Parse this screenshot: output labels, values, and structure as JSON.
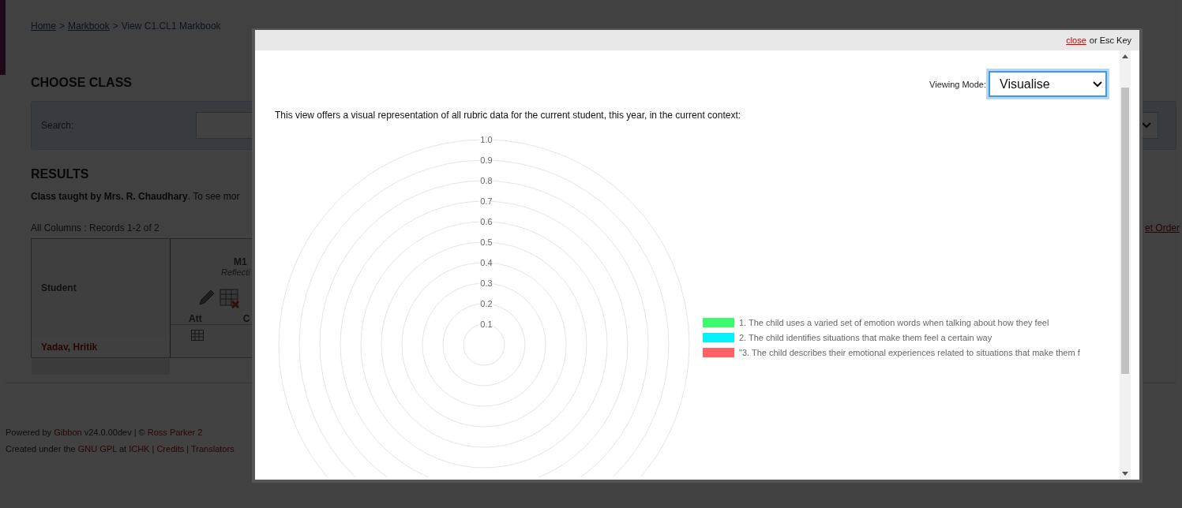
{
  "page": {
    "breadcrumb": [
      {
        "label": "Home",
        "link": true
      },
      {
        "label": "Markbook",
        "link": true
      },
      {
        "label": "View C1.CL1 Markbook",
        "link": false
      }
    ],
    "separator": ">",
    "choose_class": {
      "heading": "CHOOSE CLASS",
      "search_label": "Search:"
    },
    "results": {
      "heading": "RESULTS",
      "teacher_note": "**Class taught by Mrs. R. Chaudhary**. To see mor",
      "records": "All Columns : Records 1-2 of 2",
      "order_link": "et Order",
      "table": {
        "student_header": "Student",
        "column": {
          "title": "M1",
          "subtitle": "Reflecti",
          "sub_columns": [
            "Att",
            "C"
          ]
        },
        "rows": [
          {
            "student": "Yadav, Hritik"
          }
        ]
      }
    },
    "footer": {
      "lines": [
        [
          {
            "text": "Powered by ",
            "link": false
          },
          {
            "text": "Gibbon",
            "link": true
          },
          {
            "text": " v24.0.00dev | © ",
            "link": false
          },
          {
            "text": "Ross Parker 2",
            "link": true
          }
        ],
        [
          {
            "text": "Created under the ",
            "link": false
          },
          {
            "text": "GNU GPL",
            "link": true
          },
          {
            "text": " at ",
            "link": false
          },
          {
            "text": "ICHK",
            "link": true
          },
          {
            "text": " | ",
            "link": false
          },
          {
            "text": "Credits",
            "link": true
          },
          {
            "text": " | ",
            "link": false
          },
          {
            "text": "Translators",
            "link": true
          }
        ]
      ]
    }
  },
  "modal": {
    "close": "close",
    "close_hint": "or Esc Key",
    "viewing_mode_label": "Viewing Mode:",
    "viewing_mode": "Visualise",
    "intro": "This view offers a visual representation of all rubric data for the current student, this year, in the current context:",
    "radar": {
      "ticks": [
        "1.0",
        "0.9",
        "0.8",
        "0.7",
        "0.6",
        "0.5",
        "0.4",
        "0.3",
        "0.2",
        "0.1"
      ]
    },
    "legend": [
      {
        "label": "1. The child uses a varied set of emotion words when talking about how they feel",
        "color": "#3dfc6c"
      },
      {
        "label": "2. The child identifies situations that make them feel a certain way",
        "color": "#05f1fa"
      },
      {
        "label": "\"3. The child describes their emotional experiences related to situations that make them f",
        "color": "#ff6166"
      }
    ]
  }
}
